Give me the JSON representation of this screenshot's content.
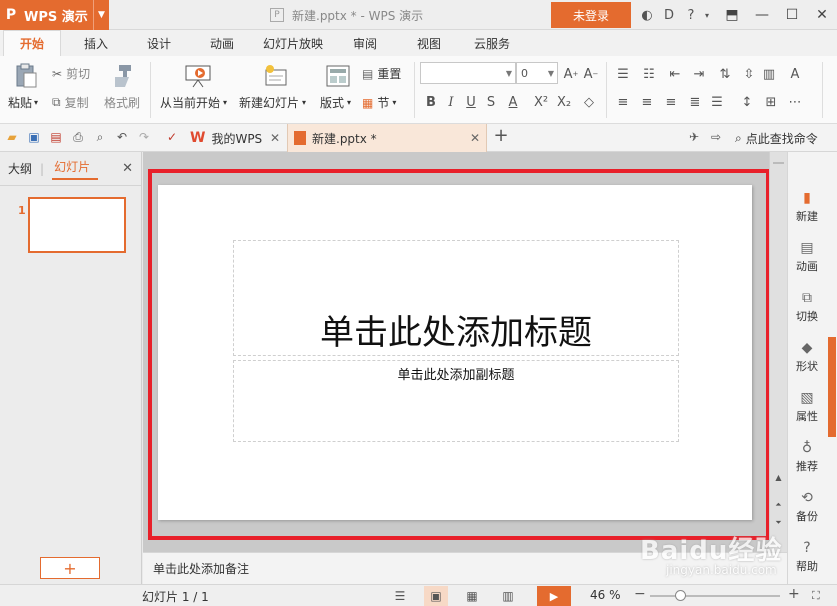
{
  "app": {
    "logo": "P",
    "name": "WPS 演示",
    "doc_title": "新建.pptx * - WPS 演示",
    "login_label": "未登录",
    "colors": {
      "accent": "#e46b2f",
      "highlight": "#e8202a"
    }
  },
  "ribbon": {
    "tabs": [
      "开始",
      "插入",
      "设计",
      "动画",
      "幻灯片放映",
      "审阅",
      "视图",
      "云服务"
    ],
    "active_tab": "开始",
    "paste": "粘贴",
    "cut": "剪切",
    "copy": "复制",
    "format_painter": "格式刷",
    "from_current": "从当前开始",
    "new_slide": "新建幻灯片",
    "layout": "版式",
    "reset": "重置",
    "section": "节",
    "font_size_value": "0"
  },
  "doc_tabs": {
    "my_wps": "我的WPS",
    "file": "新建.pptx *",
    "search_cmd": "点此查找命令"
  },
  "left_panel": {
    "tabs": [
      "大纲",
      "幻灯片"
    ],
    "active": "幻灯片",
    "slide_number": "1"
  },
  "slide": {
    "title_placeholder": "单击此处添加标题",
    "subtitle_placeholder": "单击此处添加副标题"
  },
  "notes_placeholder": "单击此处添加备注",
  "right_panel": [
    "新建",
    "动画",
    "切换",
    "形状",
    "属性",
    "推荐",
    "备份",
    "帮助"
  ],
  "status": {
    "slide_info": "幻灯片 1 / 1",
    "zoom": "46 %",
    "zoom_level": 0.46
  },
  "watermark": {
    "logo": "Baidu经验",
    "url": "jingyan.baidu.com"
  }
}
